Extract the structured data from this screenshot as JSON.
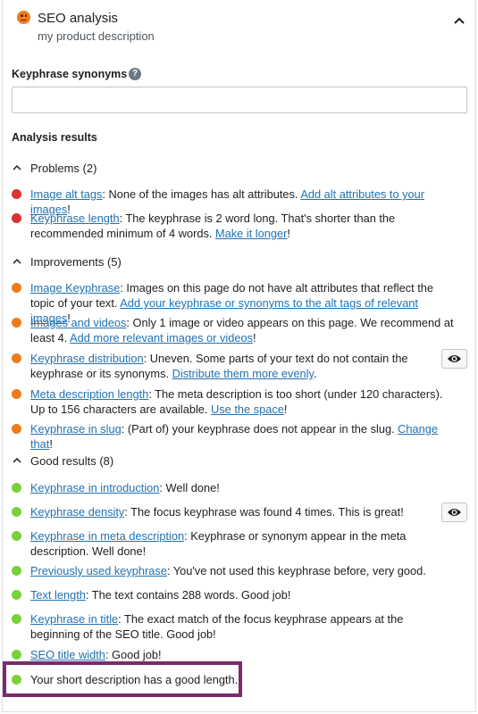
{
  "header": {
    "title": "SEO analysis",
    "subtitle": "my product description"
  },
  "synonyms": {
    "label": "Keyphrase synonyms",
    "help": "?",
    "value": "",
    "placeholder": ""
  },
  "analysis": {
    "label": "Analysis results"
  },
  "problems": {
    "heading": "Problems (2)",
    "items": [
      {
        "link": "Image alt tags",
        "text": ": None of the images has alt attributes. ",
        "action": "Add alt attributes to your images",
        "end": "!"
      },
      {
        "link": "Keyphrase length",
        "text": ": The keyphrase is 2 word long. That's shorter than the recommended minimum of 4 words. ",
        "action": "Make it longer",
        "end": "!"
      }
    ]
  },
  "improvements": {
    "heading": "Improvements (5)",
    "items": [
      {
        "link": "Image Keyphrase",
        "text": ": Images on this page do not have alt attributes that reflect the topic of your text. ",
        "action": "Add your keyphrase or synonyms to the alt tags of relevant images",
        "end": "!"
      },
      {
        "link": "Images and videos",
        "text": ": Only 1 image or video appears on this page. We recommend at least 4. ",
        "action": "Add more relevant images or videos",
        "end": "!"
      },
      {
        "link": "Keyphrase distribution",
        "text": ": Uneven. Some parts of your text do not contain the keyphrase or its synonyms. ",
        "action": "Distribute them more evenly",
        "end": "."
      },
      {
        "link": "Meta description length",
        "text": ": The meta description is too short (under 120 characters). Up to 156 characters are available. ",
        "action": "Use the space",
        "end": "!"
      },
      {
        "link": "Keyphrase in slug",
        "text": ": (Part of) your keyphrase does not appear in the slug. ",
        "action": "Change that",
        "end": "!"
      }
    ]
  },
  "good": {
    "heading": "Good results (8)",
    "items": [
      {
        "link": "Keyphrase in introduction",
        "text": ": Well done!"
      },
      {
        "link": "Keyphrase density",
        "text": ": The focus keyphrase was found 4 times. This is great!"
      },
      {
        "link": "Keyphrase in meta description",
        "text": ": Keyphrase or synonym appear in the meta description. Well done!"
      },
      {
        "link": "Previously used keyphrase",
        "text": ": You've not used this keyphrase before, very good."
      },
      {
        "link": "Text length",
        "text": ": The text contains 288 words. Good job!"
      },
      {
        "link": "Keyphrase in title",
        "text": ": The exact match of the focus keyphrase appears at the beginning of the SEO title. Good job!"
      },
      {
        "link": "SEO title width",
        "text": ": Good job!"
      },
      {
        "text": "Your short description has a good length."
      }
    ]
  },
  "colors": {
    "problem": "#dc3232",
    "improvement": "#ee7c1b",
    "good": "#7ad03a",
    "link": "#2271b1",
    "highlight": "#7b2a6d"
  },
  "icons": {
    "header": "sad-face-icon",
    "collapse": "chevron-up-icon",
    "help": "help-icon",
    "eye": "eye-icon"
  }
}
